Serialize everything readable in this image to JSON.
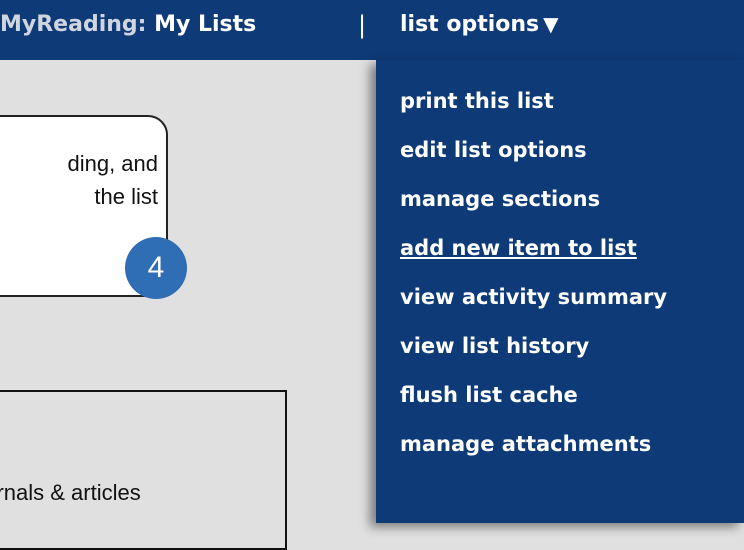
{
  "header": {
    "brand_label": "MyReading:",
    "my_lists_label": "My Lists",
    "divider": "|",
    "menu_label": "list options",
    "menu_arrow": "▼"
  },
  "dropdown": {
    "items": [
      {
        "label": "print this list"
      },
      {
        "label": "edit list options"
      },
      {
        "label": "manage sections"
      },
      {
        "label": "add new item to list"
      },
      {
        "label": "view activity summary"
      },
      {
        "label": "view list history"
      },
      {
        "label": "flush list cache"
      },
      {
        "label": "manage attachments"
      }
    ]
  },
  "callout": {
    "line1": "ding, and",
    "line2": "the list",
    "step_number": "4"
  },
  "panel": {
    "text": "ournals & articles"
  },
  "colors": {
    "header_bg": "#0e3a78",
    "badge_bg": "#2f6db5",
    "page_bg": "#e0e0e0"
  }
}
